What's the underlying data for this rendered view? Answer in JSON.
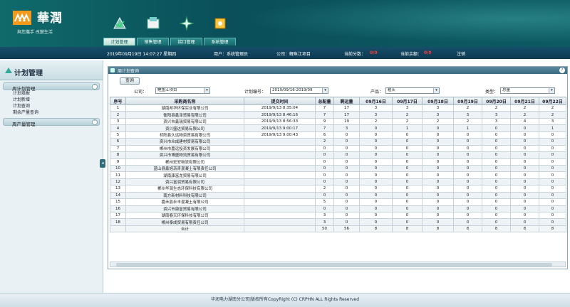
{
  "brand": {
    "name": "華潤",
    "slogan": "與您攜手 改變生活"
  },
  "tabs": [
    {
      "label": "计划管理",
      "icon": "plan-icon",
      "active": true
    },
    {
      "label": "销售管理",
      "icon": "sales-icon",
      "active": false
    },
    {
      "label": "接口管理",
      "icon": "interface-icon",
      "active": false
    },
    {
      "label": "系统管理",
      "icon": "system-icon",
      "active": false
    }
  ],
  "status": {
    "datetime": "2019年09月19日 14:07:27 星期四",
    "user": "用户：系统管理员",
    "company": "公司：鲤鱼江项目",
    "score_label": "当前分数：",
    "score_value": "0/0",
    "balance_label": "当前余额：",
    "balance_value": "0/0",
    "logout": "注销"
  },
  "sidebar": {
    "title": "计划管理",
    "groups": [
      {
        "label": "周计划管理",
        "expanded": true,
        "items": [
          "计划填报",
          "计划新增",
          "计划查询",
          "剩余产量查询"
        ]
      },
      {
        "label": "周产量管理",
        "expanded": false,
        "items": []
      }
    ]
  },
  "panel": {
    "title": "周计划查询",
    "query_button": "查询",
    "filters": {
      "company_label": "公司：",
      "company_value": "鲤鱼江项目",
      "plan_label": "计划编号：",
      "plan_value": "2019/09/16-2019/09",
      "product_label": "产品：",
      "product_value": "粗灰",
      "type_label": "类型：",
      "type_value": "总量"
    }
  },
  "table": {
    "headers": [
      "序号",
      "采购商名称",
      "提交时间",
      "总配量",
      "剩运量",
      "09月16日",
      "09月17日",
      "09月18日",
      "09月19日",
      "09月20日",
      "09月21日",
      "09月22日"
    ],
    "rows": [
      [
        "1",
        "湖南邦华环保实业有限公司",
        "2019/9/13 8:35:04",
        "7",
        "17",
        "3",
        "3",
        "3",
        "2",
        "2",
        "2",
        "2"
      ],
      [
        "2",
        "衡阳县鑫泽贸易有限公司",
        "2019/9/13 8:46:16",
        "7",
        "17",
        "3",
        "2",
        "3",
        "3",
        "3",
        "2",
        "2"
      ],
      [
        "3",
        "资兴市鑫瑞贸易有限公司",
        "2019/9/13 8:56:33",
        "9",
        "19",
        "2",
        "2",
        "2",
        "2",
        "3",
        "4",
        "3"
      ],
      [
        "4",
        "资兴盛达贸易有限公司",
        "2019/9/13 9:00:17",
        "7",
        "3",
        "0",
        "1",
        "0",
        "1",
        "0",
        "0",
        "1"
      ],
      [
        "5",
        "祁阳县久远物资贸易有限公司",
        "2019/9/13 9:00:43",
        "6",
        "0",
        "0",
        "0",
        "0",
        "0",
        "0",
        "0",
        "0"
      ],
      [
        "6",
        "资兴市众成建材贸易有限公司",
        "",
        "2",
        "0",
        "0",
        "0",
        "0",
        "0",
        "0",
        "0",
        "0"
      ],
      [
        "7",
        "郴州市嘉远投资发展有限公司",
        "",
        "0",
        "0",
        "0",
        "0",
        "0",
        "0",
        "0",
        "0",
        "0"
      ],
      [
        "8",
        "资兴市博盛物流贸易有限公司",
        "",
        "0",
        "0",
        "0",
        "0",
        "0",
        "0",
        "0",
        "0",
        "0"
      ],
      [
        "9",
        "郴州宏安物流有限公司",
        "",
        "0",
        "0",
        "0",
        "0",
        "0",
        "0",
        "0",
        "0",
        "0"
      ],
      [
        "10",
        "蓝山县鑫旭沥青混凝土有限责任公司",
        "",
        "0",
        "0",
        "0",
        "0",
        "0",
        "0",
        "0",
        "0",
        "0"
      ],
      [
        "11",
        "湖南康富龙贸易有限公司",
        "",
        "0",
        "0",
        "0",
        "0",
        "0",
        "0",
        "0",
        "0",
        "0"
      ],
      [
        "12",
        "资兴富润贸易有限公司",
        "",
        "0",
        "0",
        "0",
        "0",
        "0",
        "0",
        "0",
        "0",
        "0"
      ],
      [
        "13",
        "郴州华润生态环保科技有限公司",
        "",
        "2",
        "0",
        "0",
        "0",
        "0",
        "0",
        "0",
        "0",
        "0"
      ],
      [
        "14",
        "南方新材料科技有限公司",
        "",
        "0",
        "0",
        "0",
        "0",
        "0",
        "0",
        "0",
        "0",
        "0"
      ],
      [
        "15",
        "嘉禾县永丰混凝土有限公司",
        "",
        "5",
        "0",
        "0",
        "0",
        "0",
        "0",
        "0",
        "0",
        "0"
      ],
      [
        "16",
        "资兴市康富贸易有限公司",
        "",
        "0",
        "0",
        "0",
        "0",
        "0",
        "0",
        "0",
        "0",
        "0"
      ],
      [
        "17",
        "湖南春天环保科技有限公司",
        "",
        "3",
        "0",
        "0",
        "0",
        "0",
        "0",
        "0",
        "0",
        "0"
      ],
      [
        "18",
        "郴州泰成贸易有限责任公司",
        "",
        "3",
        "0",
        "0",
        "0",
        "0",
        "0",
        "0",
        "0",
        "0"
      ]
    ],
    "total": [
      "",
      "合计",
      "",
      "50",
      "56",
      "8",
      "8",
      "8",
      "8",
      "8",
      "8",
      "8"
    ]
  },
  "footer": "华润电力湖南分公司|版权所有CopyRight (C) CRPHN ALL Rights Reserved",
  "colors": {
    "header": "#0a4f5a",
    "accent_red": "#ff3a3a",
    "panel_header": "#3a6a80"
  }
}
